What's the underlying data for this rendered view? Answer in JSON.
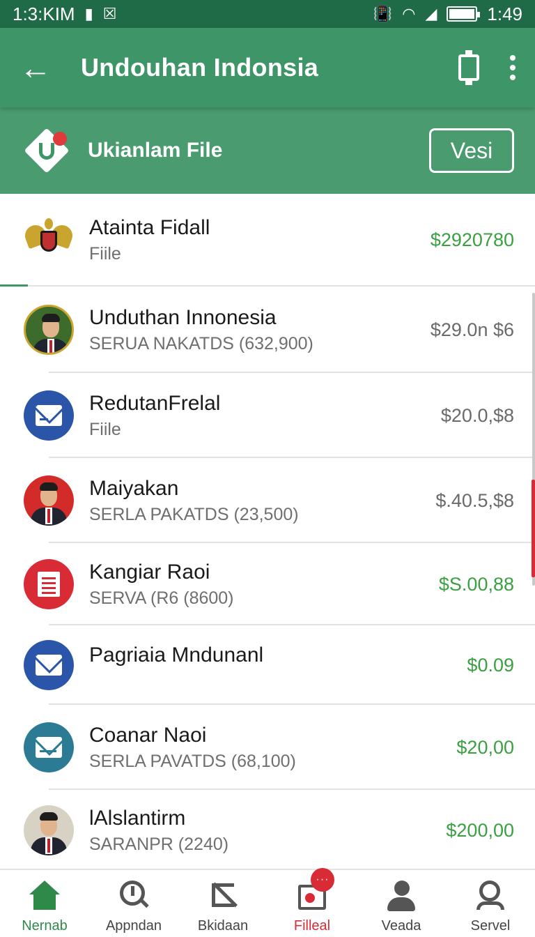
{
  "status_bar": {
    "time_left": "1:3:KIM",
    "time_right": "1:49"
  },
  "app_bar": {
    "title": "Undouhan Indonsia"
  },
  "sub_header": {
    "title": "Ukianlam File",
    "version_label": "Vesi"
  },
  "items": [
    {
      "title": "Atainta Fidall",
      "subtitle": "Fiile",
      "amount": "$2920780",
      "amount_color": "green",
      "icon": "emblem"
    },
    {
      "title": "Unduthan Innonesia",
      "subtitle": "SERUA NAKATDS (632,900)",
      "amount": "$29.0n $6",
      "amount_color": "gray",
      "icon": "person"
    },
    {
      "title": "RedutanFrelal",
      "subtitle": "Fiile",
      "amount": "$20.0,$8",
      "amount_color": "gray",
      "icon": "mail-icon"
    },
    {
      "title": "Maiyakan",
      "subtitle": "SERLA PAKATDS (23,500)",
      "amount": "$.40.5,$8",
      "amount_color": "gray",
      "icon": "person"
    },
    {
      "title": "Kangiar Raoi",
      "subtitle": "SERVA (R6 (8600)",
      "amount": "$S.00,88",
      "amount_color": "green",
      "icon": "document-icon"
    },
    {
      "title": "Pagriaia Mndunanl",
      "subtitle": "",
      "amount": "$0.09",
      "amount_color": "green",
      "icon": "mail-icon"
    },
    {
      "title": "Coanar Naoi",
      "subtitle": "SERLA PAVATDS (68,100)",
      "amount": "$20,00",
      "amount_color": "green",
      "icon": "inbox-icon"
    },
    {
      "title": "lAlslantirm",
      "subtitle": "SARANPR (2240)",
      "amount": "$200,00",
      "amount_color": "green",
      "icon": "person"
    }
  ],
  "bottom_nav": [
    {
      "label": "Nernab",
      "icon": "home-icon",
      "active": "green"
    },
    {
      "label": "Appndan",
      "icon": "clock-search-icon",
      "active": ""
    },
    {
      "label": "Bkidaan",
      "icon": "crop-icon",
      "active": ""
    },
    {
      "label": "Filleal",
      "icon": "file-record-icon",
      "active": "red",
      "badge": "···"
    },
    {
      "label": "Veada",
      "icon": "user-icon",
      "active": ""
    },
    {
      "label": "Servel",
      "icon": "user-search-icon",
      "active": ""
    }
  ],
  "colors": {
    "primary": "#3e9567",
    "status_bar": "#1f6b47",
    "positive": "#3aa042",
    "accent_red": "#d82b35"
  }
}
